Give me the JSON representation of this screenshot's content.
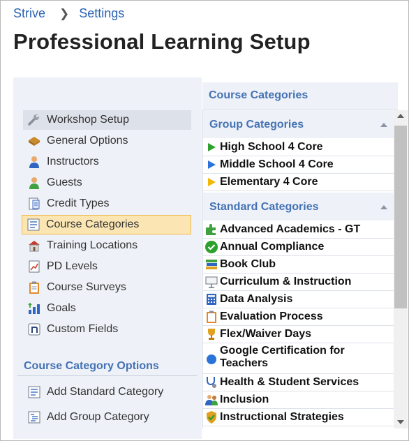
{
  "breadcrumb": {
    "root": "Strive",
    "current": "Settings"
  },
  "page": {
    "title": "Professional Learning Setup"
  },
  "nav": {
    "items": [
      {
        "label": "Workshop Setup",
        "icon": "wrench-icon"
      },
      {
        "label": "General Options",
        "icon": "package-icon"
      },
      {
        "label": "Instructors",
        "icon": "instructor-icon"
      },
      {
        "label": "Guests",
        "icon": "guest-icon"
      },
      {
        "label": "Credit Types",
        "icon": "credit-icon"
      },
      {
        "label": "Course Categories",
        "icon": "list-icon"
      },
      {
        "label": "Training Locations",
        "icon": "building-icon"
      },
      {
        "label": "PD Levels",
        "icon": "chart-icon"
      },
      {
        "label": "Course Surveys",
        "icon": "clipboard-icon"
      },
      {
        "label": "Goals",
        "icon": "goals-icon"
      },
      {
        "label": "Custom Fields",
        "icon": "custom-field-icon"
      }
    ],
    "hovered": "Workshop Setup",
    "active": "Course Categories"
  },
  "options": {
    "title": "Course Category Options",
    "items": [
      {
        "label": "Add Standard Category",
        "icon": "add-standard-icon"
      },
      {
        "label": "Add Group Category",
        "icon": "add-group-icon"
      }
    ]
  },
  "panel": {
    "title": "Course Categories",
    "group_section": "Group Categories",
    "group_items": [
      {
        "label": "High School 4 Core",
        "color": "#2ea02e"
      },
      {
        "label": "Middle School 4 Core",
        "color": "#2a73d8"
      },
      {
        "label": "Elementary 4 Core",
        "color": "#f2b705"
      }
    ],
    "standard_section": "Standard Categories",
    "standard_items": [
      {
        "label": "Advanced Academics - GT",
        "icon": "puzzle-icon"
      },
      {
        "label": "Annual Compliance",
        "icon": "check-circle-icon"
      },
      {
        "label": "Book Club",
        "icon": "books-icon"
      },
      {
        "label": "Curriculum & Instruction",
        "icon": "presentation-icon"
      },
      {
        "label": "Data Analysis",
        "icon": "calculator-icon"
      },
      {
        "label": "Evaluation Process",
        "icon": "clipboard-icon"
      },
      {
        "label": "Flex/Waiver Days",
        "icon": "trophy-icon"
      },
      {
        "label": "Google Certification for Teachers",
        "icon": "blue-dot-icon"
      },
      {
        "label": "Health & Student Services",
        "icon": "stethoscope-icon"
      },
      {
        "label": "Inclusion",
        "icon": "people-icon"
      },
      {
        "label": "Instructional Strategies",
        "icon": "shield-check-icon"
      }
    ]
  }
}
